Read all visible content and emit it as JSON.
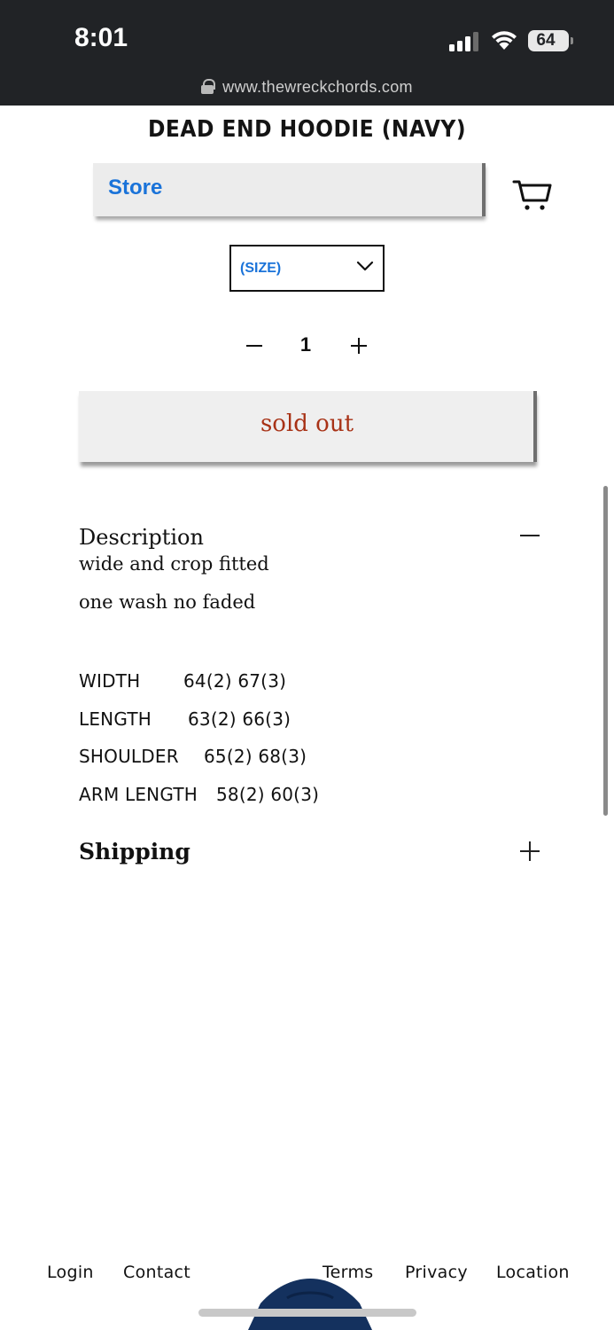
{
  "status_bar": {
    "time": "8:01",
    "battery": "64",
    "url": "www.thewreckchords.com"
  },
  "product": {
    "title": "DEAD END HOODIE (NAVY)",
    "store_label": "Store",
    "size_select": "(SIZE)",
    "quantity": "1",
    "sold_out_label": "sold out"
  },
  "description": {
    "heading": "Description",
    "lines": [
      "wide and crop fitted",
      "one wash no faded"
    ],
    "specs": [
      {
        "label": "WIDTH",
        "value": "64(2) 67(3)"
      },
      {
        "label": "LENGTH",
        "value": "63(2) 66(3)"
      },
      {
        "label": "SHOULDER",
        "value": "65(2) 68(3)"
      },
      {
        "label": "ARM LENGTH",
        "value": "58(2) 60(3)"
      }
    ]
  },
  "shipping": {
    "heading": "Shipping"
  },
  "footer": {
    "links": [
      "Login",
      "Contact",
      "Terms",
      "Privacy",
      "Location"
    ]
  },
  "colors": {
    "status_bar_bg": "#212326",
    "link_blue": "#1a73d9",
    "sold_out_red": "#a83216",
    "hoodie_navy": "#14315e"
  },
  "icons": {
    "cart": "cart-icon",
    "lock": "lock-icon",
    "chevron": "chevron-down-icon",
    "minus": "minus-icon",
    "plus": "plus-icon"
  }
}
